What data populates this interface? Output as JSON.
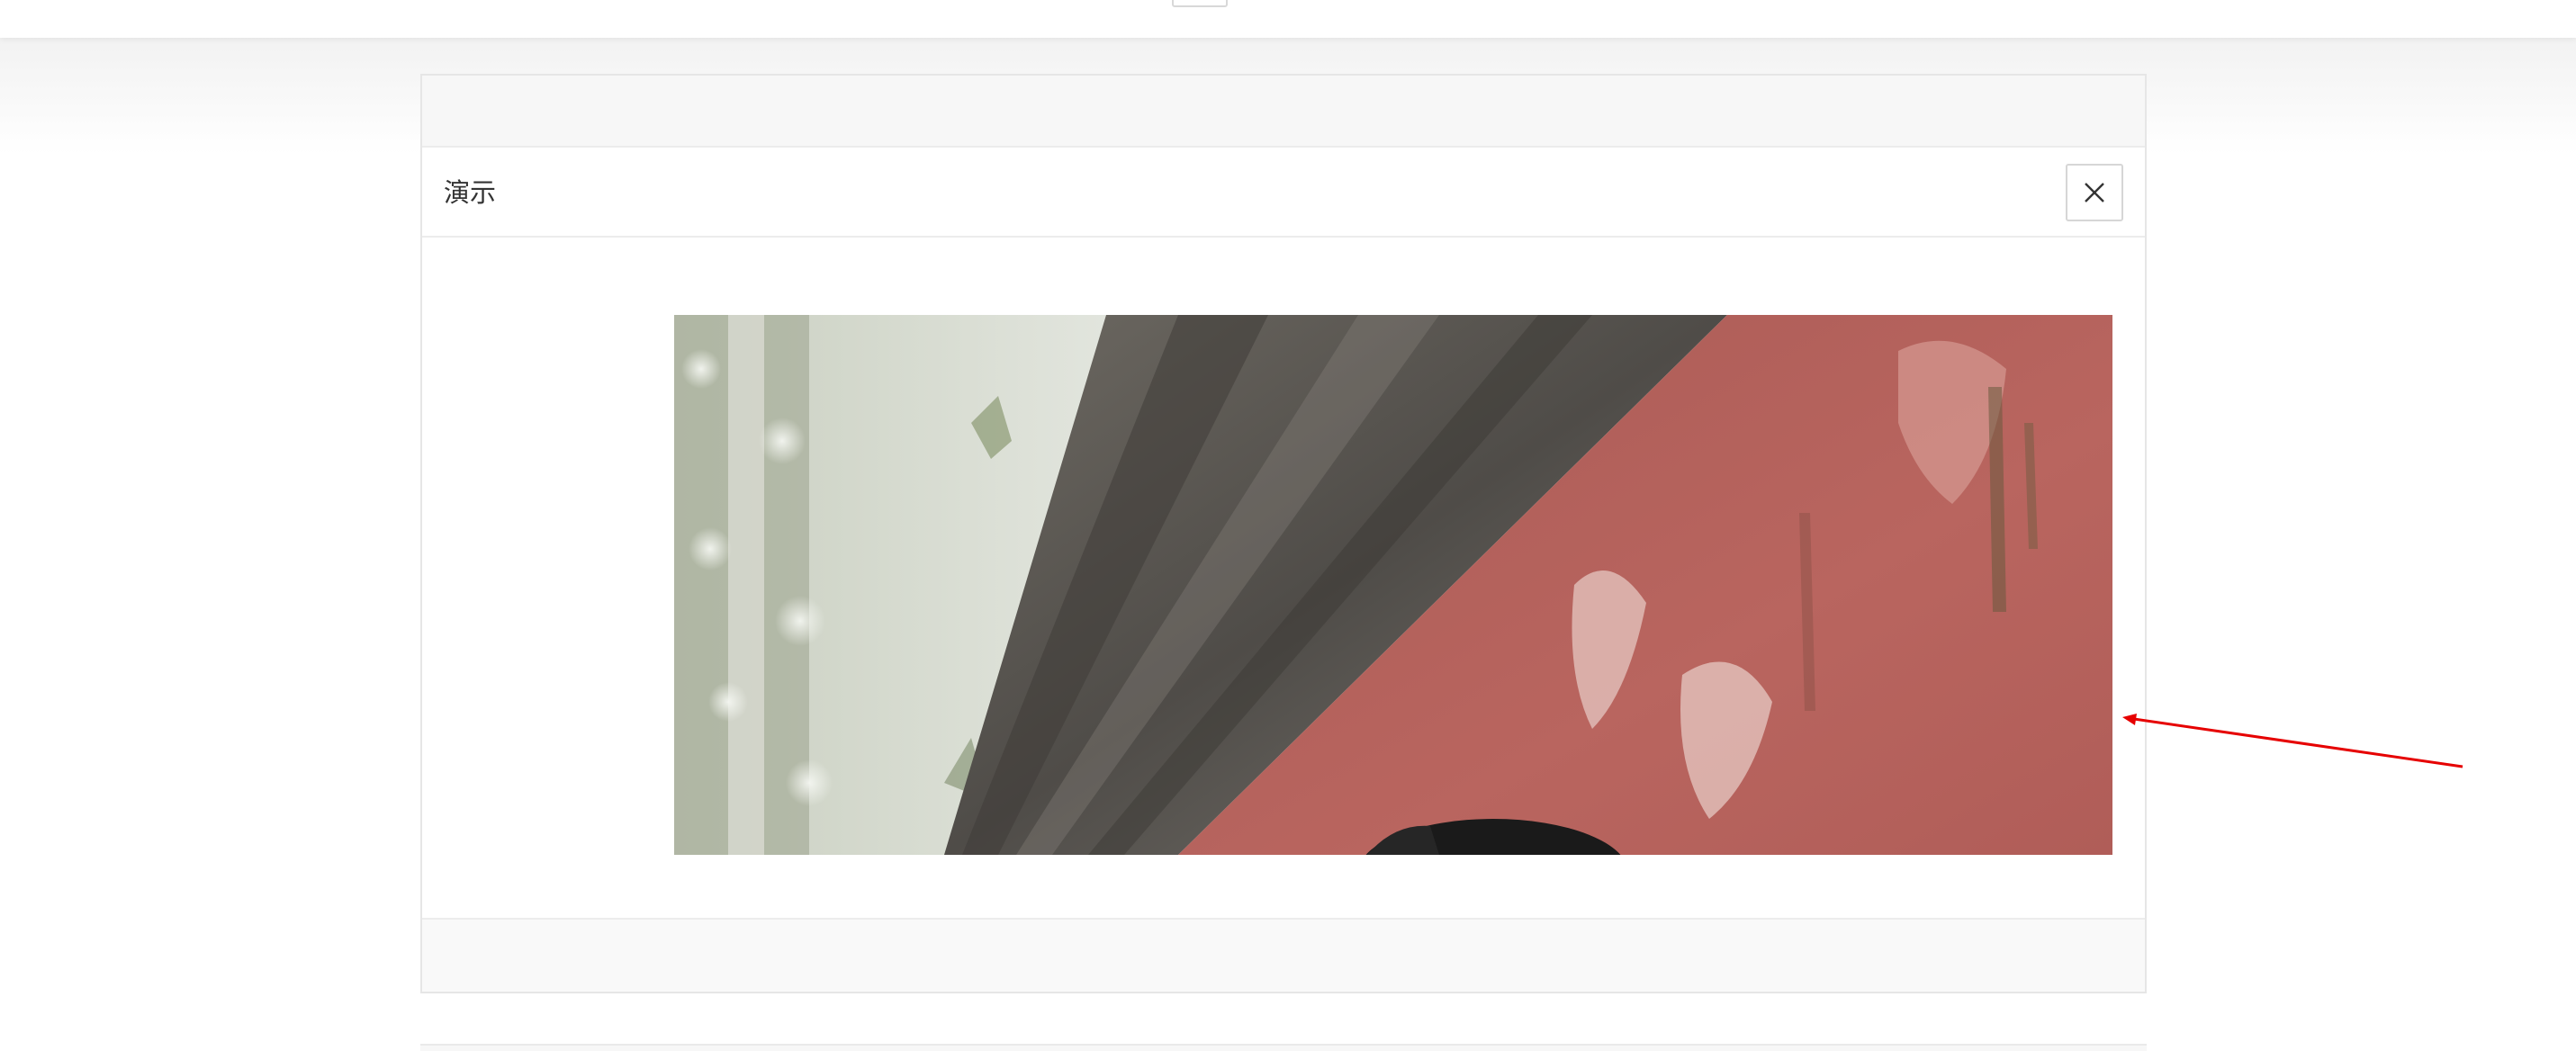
{
  "panel": {
    "title": "演示",
    "close_icon": "close-icon"
  },
  "photo": {
    "subject": "photo-red-wall-eave",
    "colors": {
      "wall_red": "#b5615c",
      "roof_gray": "#5b5854",
      "foliage_green": "#8f9a7e",
      "hair_black": "#1a1a1a"
    }
  },
  "annotation": {
    "icon": "arrow-icon",
    "color": "#e60000"
  }
}
